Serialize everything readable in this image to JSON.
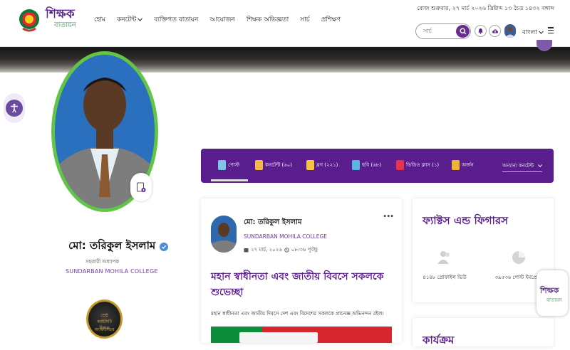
{
  "header": {
    "logo_line1": "শিক্ষক",
    "logo_line2": "বাতায়ন",
    "date": "রোজ শুক্রবার, ২৭ মার্চ ২০২৬ খ্রিষ্টাব্দ ১৩ চৈত্র ১৪৩২ বঙ্গাব্দ",
    "nav": [
      "হোম",
      "কনটেন্ট",
      "ব্যক্তিগত বাতায়ন",
      "আয়োজন",
      "শিক্ষক অভিজ্ঞতা",
      "সার্চ",
      "প্রশিক্ষণ"
    ],
    "search_placeholder": "সার্চ",
    "language": "বাংলা"
  },
  "profile": {
    "name": "মো: তরিকুল ইসলাম",
    "role": "সহকারী অধ্যাপক",
    "institution": "SUNDARBAN MOHILA COLLEGE",
    "badge_line1": "শ্রেষ্ঠ",
    "badge_line2": "আইসিটি অ্যাম্বাসেডর",
    "badge_line3": "শিক্ষক"
  },
  "tabs": {
    "items": [
      {
        "label": "পোস্ট",
        "icon": "post-icon",
        "color": "#7ec6e8"
      },
      {
        "label": "কনটেন্ট (৬০)",
        "icon": "content-icon",
        "color": "#f0b94a"
      },
      {
        "label": "ব্লগ (২২১)",
        "icon": "blog-icon",
        "color": "#f5c542"
      },
      {
        "label": "ছবি (৬৮)",
        "icon": "photo-icon",
        "color": "#57b7e0"
      },
      {
        "label": "ভিডিও ক্লাস (১)",
        "icon": "video-icon",
        "color": "#e8334a"
      },
      {
        "label": "অর্জন",
        "icon": "award-icon",
        "color": "#f0b432"
      }
    ],
    "other": "অন্যান্য কনটেন্ট"
  },
  "post": {
    "author": "মো: তরিকুল ইসলাম",
    "institution": "SUNDARBAN MOHILA COLLEGE",
    "date": "২৭ মার্চ, ২০২৬",
    "time": "০৮:৩৬ পূর্বাহ্ণ",
    "title": "মহান স্বাধীনতা এবং জাতীয় বিবসে সকলকে শুভেচ্ছা",
    "excerpt": "মহান স্বাধীনতা এবং জাতীয় দিবসে দেশ এবং বিদেশের সকলকে প্রানেজ্ঞ অভিনন্দন রইল।"
  },
  "facts": {
    "title": "ফ্যাক্টস এন্ড ফিগারস",
    "stats": [
      {
        "label": "৪১৪৮ প্রোফাইল ভিউ",
        "icon": "users-icon"
      },
      {
        "label": "৩৯৫৩৬ পোস্ট ইমপ্রেশন",
        "icon": "pie-chart-icon"
      }
    ]
  },
  "karyokrom": {
    "title": "কার্যক্রম"
  },
  "float_logo": {
    "line1": "শিক্ষক",
    "line2": "বাতায়ন"
  },
  "colors": {
    "brand": "#5a1d8d",
    "accent_green": "#62c545",
    "verified": "#4a90d9"
  }
}
